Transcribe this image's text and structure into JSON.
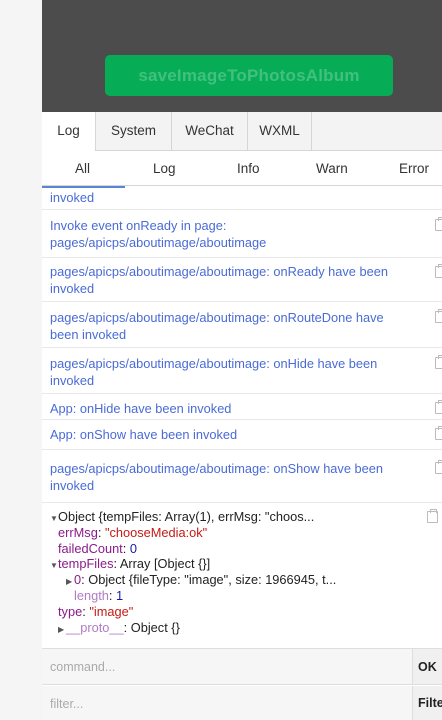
{
  "preview": {
    "button_label": "saveImageToPhotosAlbum"
  },
  "tabs": [
    "Log",
    "System",
    "WeChat",
    "WXML"
  ],
  "filters": [
    "All",
    "Log",
    "Info",
    "Warn",
    "Error"
  ],
  "logs": [
    {
      "line1": "invoked",
      "line2": ""
    },
    {
      "line1": "Invoke event onReady in page:",
      "line2": "pages/apicps/aboutimage/aboutimage"
    },
    {
      "line1": "pages/apicps/aboutimage/aboutimage: onReady have been",
      "line2": "invoked"
    },
    {
      "line1": "pages/apicps/aboutimage/aboutimage: onRouteDone have",
      "line2": "been invoked"
    },
    {
      "line1": "pages/apicps/aboutimage/aboutimage: onHide have been",
      "line2": "invoked"
    },
    {
      "line1": "App: onHide have been invoked",
      "line2": ""
    },
    {
      "line1": "App: onShow have been invoked",
      "line2": ""
    },
    {
      "line1": "pages/apicps/aboutimage/aboutimage: onShow have been",
      "line2": "invoked"
    }
  ],
  "object": {
    "summary": "Object {tempFiles: Array(1), errMsg: \"choos...",
    "errMsg_key": "errMsg",
    "errMsg_val": "\"chooseMedia:ok\"",
    "failedCount_key": "failedCount",
    "failedCount_val": "0",
    "tempFiles_key": "tempFiles",
    "tempFiles_val": "Array [Object {}]",
    "item0_key": "0",
    "item0_val": "Object {fileType: \"image\", size: 1966945, t...",
    "length_key": "length",
    "length_val": "1",
    "type_key": "type",
    "type_val": "\"image\"",
    "proto_key": "__proto__",
    "proto_val": "Object {}"
  },
  "console": {
    "command_placeholder": "command...",
    "command_button": "OK",
    "filter_placeholder": "filter...",
    "filter_button": "Filter"
  }
}
